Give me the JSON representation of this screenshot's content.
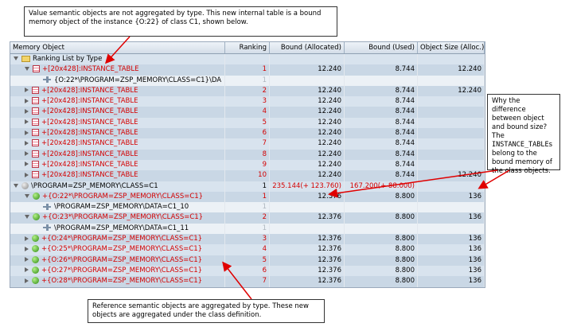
{
  "notes": {
    "top": "Value semantic objects are not aggregated by type. This new internal table is a bound memory object of the instance {O:22} of class C1, shown below.",
    "right_a": "Why the difference between object and bound size? The",
    "right_code": "INSTANCE_TABLE",
    "right_s": "s",
    "right_b": "belong to the bound memory of the class objects.",
    "bottom": "Reference semantic objects are aggregated by type. These new objects are aggregated under the class definition."
  },
  "columns": [
    "Memory Object",
    "Ranking",
    "Bound (Allocated)",
    "Bound (Used)",
    "Object Size (Alloc.)"
  ],
  "rows": [
    {
      "indent": 0,
      "tri": "d",
      "icon": "folder",
      "label": "Ranking List by Type",
      "red": false,
      "rank": "",
      "alloc": "",
      "used": "",
      "size": ""
    },
    {
      "indent": 1,
      "tri": "d",
      "icon": "tbl",
      "label": "+[20x428]:INSTANCE_TABLE",
      "red": true,
      "rank": "1",
      "alloc": "12.240",
      "used": "8.744",
      "size": "12.240"
    },
    {
      "indent": 2,
      "tri": "",
      "icon": "ref",
      "label": "{O:22*\\PROGRAM=ZSP_MEMORY\\CLASS=C1}\\DA",
      "red": false,
      "rank": "1",
      "rankGray": true,
      "alloc": "",
      "used": "",
      "size": "",
      "white": true
    },
    {
      "indent": 1,
      "tri": "r",
      "icon": "tbl",
      "label": "+[20x428]:INSTANCE_TABLE",
      "red": true,
      "rank": "2",
      "alloc": "12.240",
      "used": "8.744",
      "size": "12.240"
    },
    {
      "indent": 1,
      "tri": "r",
      "icon": "tbl",
      "label": "+[20x428]:INSTANCE_TABLE",
      "red": true,
      "rank": "3",
      "alloc": "12.240",
      "used": "8.744",
      "size": ""
    },
    {
      "indent": 1,
      "tri": "r",
      "icon": "tbl",
      "label": "+[20x428]:INSTANCE_TABLE",
      "red": true,
      "rank": "4",
      "alloc": "12.240",
      "used": "8.744",
      "size": ""
    },
    {
      "indent": 1,
      "tri": "r",
      "icon": "tbl",
      "label": "+[20x428]:INSTANCE_TABLE",
      "red": true,
      "rank": "5",
      "alloc": "12.240",
      "used": "8.744",
      "size": ""
    },
    {
      "indent": 1,
      "tri": "r",
      "icon": "tbl",
      "label": "+[20x428]:INSTANCE_TABLE",
      "red": true,
      "rank": "6",
      "alloc": "12.240",
      "used": "8.744",
      "size": ""
    },
    {
      "indent": 1,
      "tri": "r",
      "icon": "tbl",
      "label": "+[20x428]:INSTANCE_TABLE",
      "red": true,
      "rank": "7",
      "alloc": "12.240",
      "used": "8.744",
      "size": ""
    },
    {
      "indent": 1,
      "tri": "r",
      "icon": "tbl",
      "label": "+[20x428]:INSTANCE_TABLE",
      "red": true,
      "rank": "8",
      "alloc": "12.240",
      "used": "8.744",
      "size": ""
    },
    {
      "indent": 1,
      "tri": "r",
      "icon": "tbl",
      "label": "+[20x428]:INSTANCE_TABLE",
      "red": true,
      "rank": "9",
      "alloc": "12.240",
      "used": "8.744",
      "size": ""
    },
    {
      "indent": 1,
      "tri": "r",
      "icon": "tbl",
      "label": "+[20x428]:INSTANCE_TABLE",
      "red": true,
      "rank": "10",
      "alloc": "12.240",
      "used": "8.744",
      "size": "12.240"
    },
    {
      "indent": 0,
      "tri": "d",
      "icon": "ballgray",
      "label": "\\PROGRAM=ZSP_MEMORY\\CLASS=C1",
      "red": false,
      "rank": "1",
      "alloc": "235.144(+ 123.760)",
      "allocRed": true,
      "used": "167.200(+ 88.000)",
      "usedRed": true,
      "size": ""
    },
    {
      "indent": 1,
      "tri": "d",
      "icon": "ball",
      "label": "+{O:22*\\PROGRAM=ZSP_MEMORY\\CLASS=C1}",
      "red": true,
      "rank": "1",
      "alloc": "12.376",
      "used": "8.800",
      "size": "136"
    },
    {
      "indent": 2,
      "tri": "",
      "icon": "ref",
      "label": "\\PROGRAM=ZSP_MEMORY\\DATA=C1_10",
      "red": false,
      "rank": "1",
      "rankGray": true,
      "alloc": "",
      "used": "",
      "size": "",
      "white": true
    },
    {
      "indent": 1,
      "tri": "d",
      "icon": "ball",
      "label": "+{O:23*\\PROGRAM=ZSP_MEMORY\\CLASS=C1}",
      "red": true,
      "rank": "2",
      "alloc": "12.376",
      "used": "8.800",
      "size": "136"
    },
    {
      "indent": 2,
      "tri": "",
      "icon": "ref",
      "label": "\\PROGRAM=ZSP_MEMORY\\DATA=C1_11",
      "red": false,
      "rank": "1",
      "rankGray": true,
      "alloc": "",
      "used": "",
      "size": "",
      "white": true
    },
    {
      "indent": 1,
      "tri": "r",
      "icon": "ball",
      "label": "+{O:24*\\PROGRAM=ZSP_MEMORY\\CLASS=C1}",
      "red": true,
      "rank": "3",
      "alloc": "12.376",
      "used": "8.800",
      "size": "136"
    },
    {
      "indent": 1,
      "tri": "r",
      "icon": "ball",
      "label": "+{O:25*\\PROGRAM=ZSP_MEMORY\\CLASS=C1}",
      "red": true,
      "rank": "4",
      "alloc": "12.376",
      "used": "8.800",
      "size": "136"
    },
    {
      "indent": 1,
      "tri": "r",
      "icon": "ball",
      "label": "+{O:26*\\PROGRAM=ZSP_MEMORY\\CLASS=C1}",
      "red": true,
      "rank": "5",
      "alloc": "12.376",
      "used": "8.800",
      "size": "136"
    },
    {
      "indent": 1,
      "tri": "r",
      "icon": "ball",
      "label": "+{O:27*\\PROGRAM=ZSP_MEMORY\\CLASS=C1}",
      "red": true,
      "rank": "6",
      "alloc": "12.376",
      "used": "8.800",
      "size": "136"
    },
    {
      "indent": 1,
      "tri": "r",
      "icon": "ball",
      "label": "+{O:28*\\PROGRAM=ZSP_MEMORY\\CLASS=C1}",
      "red": true,
      "rank": "7",
      "alloc": "12.376",
      "used": "8.800",
      "size": "136"
    }
  ],
  "colors": {
    "accent_red": "#d40000",
    "row_blue": "#d8e3ee"
  }
}
